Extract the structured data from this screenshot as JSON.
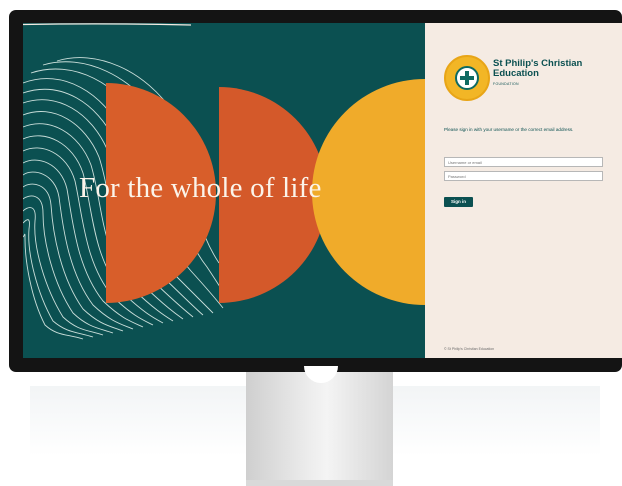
{
  "hero": {
    "tagline": "For the whole of life"
  },
  "login": {
    "org_name": "St Philip's Christian Education",
    "org_sub": "FOUNDATION",
    "instructions": "Please sign in with your username or the correct email address.",
    "email_placeholder": "Username or email",
    "password_placeholder": "Password",
    "sign_in_label": "Sign in",
    "footer": "© St Philip's Christian Education"
  },
  "colors": {
    "teal": "#0b5051",
    "orange": "#d85e2a",
    "gold": "#f0ab2a",
    "cream": "#f5ebe3"
  }
}
